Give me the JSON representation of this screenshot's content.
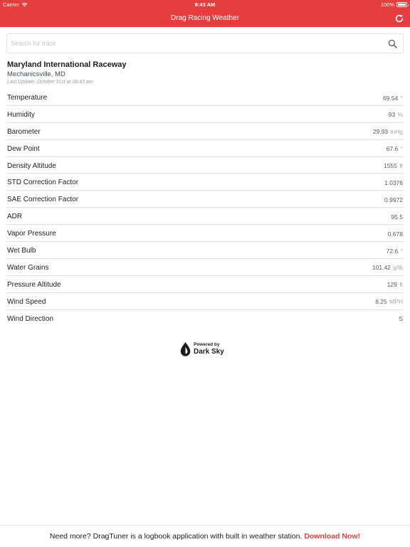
{
  "status_bar": {
    "carrier": "Carrier",
    "time": "8:43 AM",
    "battery": "100%",
    "icons": [
      "wifi-icon",
      "battery-icon"
    ]
  },
  "nav": {
    "title": "Drag Racing Weather",
    "refresh_icon": "refresh-icon"
  },
  "search": {
    "placeholder": "Search for track",
    "value": "",
    "icon": "search-icon"
  },
  "track": {
    "name": "Maryland International Raceway",
    "location": "Mechanicsville, MD",
    "last_update": "Last Update: October 31st at 08:43 am"
  },
  "weather": [
    {
      "label": "Temperature",
      "value": "69.54",
      "unit": "°"
    },
    {
      "label": "Humidity",
      "value": "93",
      "unit": "%"
    },
    {
      "label": "Barometer",
      "value": "29.93",
      "unit": "inHg"
    },
    {
      "label": "Dew Point",
      "value": "67.6",
      "unit": "°"
    },
    {
      "label": "Density Altitude",
      "value": "1555",
      "unit": "ft"
    },
    {
      "label": "STD Correction Factor",
      "value": "1.0376",
      "unit": ""
    },
    {
      "label": "SAE Correction Factor",
      "value": "0.9972",
      "unit": ""
    },
    {
      "label": "ADR",
      "value": "95.5",
      "unit": ""
    },
    {
      "label": "Vapor Pressure",
      "value": "0.678",
      "unit": ""
    },
    {
      "label": "Wet Bulb",
      "value": "72.6",
      "unit": "°"
    },
    {
      "label": "Water Grains",
      "value": "101.42",
      "unit": "g/lb"
    },
    {
      "label": "Pressure Altitude",
      "value": "129",
      "unit": "ft"
    },
    {
      "label": "Wind Speed",
      "value": "8.25",
      "unit": "MPH"
    },
    {
      "label": "Wind Direction",
      "value": "S",
      "unit": ""
    }
  ],
  "powered_by": {
    "small": "Powered by",
    "big": "Dark Sky",
    "logo_icon": "dark-sky-logo-icon"
  },
  "footer": {
    "text": "Need more? DragTuner is a logbook application with built in weather station. ",
    "link": "Download Now!"
  },
  "colors": {
    "accent": "#e63e3f",
    "text": "#1c1c1e",
    "muted": "#a0a6ad"
  }
}
